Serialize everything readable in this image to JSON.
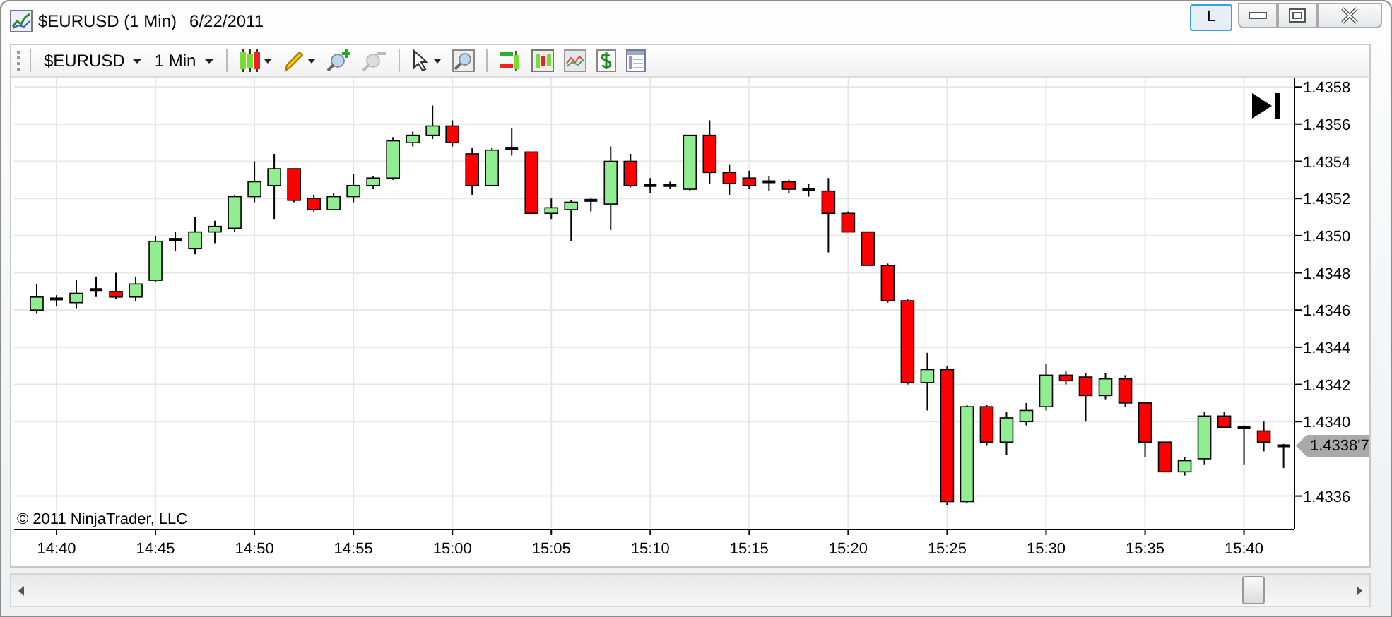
{
  "window": {
    "title": "$EURUSD (1 Min)",
    "date": "6/22/2011",
    "link_button": "L"
  },
  "toolbar": {
    "instrument": "$EURUSD",
    "interval": "1 Min"
  },
  "chart": {
    "copyright": "© 2011 NinjaTrader, LLC",
    "last_price_label": "1.4338'7",
    "chart_data": {
      "type": "candlestick",
      "grid": true,
      "categories": [
        null,
        "14:40",
        null,
        null,
        null,
        null,
        "14:45",
        null,
        null,
        null,
        null,
        "14:50",
        null,
        null,
        null,
        null,
        "14:55",
        null,
        null,
        null,
        null,
        "15:00",
        null,
        null,
        null,
        null,
        "15:05",
        null,
        null,
        null,
        null,
        "15:10",
        null,
        null,
        null,
        null,
        "15:15",
        null,
        null,
        null,
        null,
        "15:20",
        null,
        null,
        null,
        null,
        "15:25",
        null,
        null,
        null,
        null,
        "15:30",
        null,
        null,
        null,
        null,
        "15:35",
        null,
        null,
        null,
        null,
        "15:40",
        null,
        null
      ],
      "ohlc": [
        [
          1.4346,
          1.43474,
          1.43458,
          1.43467
        ],
        [
          1.43465,
          1.43468,
          1.43462,
          1.43466
        ],
        [
          1.43464,
          1.43476,
          1.43461,
          1.43469
        ],
        [
          1.4347,
          1.43478,
          1.43467,
          1.43471
        ],
        [
          1.4347,
          1.4348,
          1.43466,
          1.43467
        ],
        [
          1.43467,
          1.43478,
          1.43465,
          1.43474
        ],
        [
          1.43476,
          1.435,
          1.43475,
          1.43497
        ],
        [
          1.43497,
          1.43502,
          1.43492,
          1.43498
        ],
        [
          1.43493,
          1.4351,
          1.4349,
          1.43502
        ],
        [
          1.43502,
          1.43508,
          1.43496,
          1.43505
        ],
        [
          1.43504,
          1.43522,
          1.43502,
          1.43521
        ],
        [
          1.43521,
          1.4354,
          1.43518,
          1.43529
        ],
        [
          1.43527,
          1.43544,
          1.43509,
          1.43536
        ],
        [
          1.43536,
          1.43536,
          1.43518,
          1.43519
        ],
        [
          1.4352,
          1.43522,
          1.43513,
          1.43514
        ],
        [
          1.43514,
          1.43523,
          1.43514,
          1.43521
        ],
        [
          1.43521,
          1.43533,
          1.43518,
          1.43527
        ],
        [
          1.43527,
          1.43532,
          1.43525,
          1.43531
        ],
        [
          1.43531,
          1.43553,
          1.4353,
          1.43551
        ],
        [
          1.4355,
          1.43556,
          1.43548,
          1.43554
        ],
        [
          1.43554,
          1.4357,
          1.43552,
          1.43559
        ],
        [
          1.43559,
          1.43562,
          1.43548,
          1.4355
        ],
        [
          1.43544,
          1.43547,
          1.43522,
          1.43527
        ],
        [
          1.43527,
          1.43547,
          1.43527,
          1.43546
        ],
        [
          1.43546,
          1.43558,
          1.43543,
          1.43547
        ],
        [
          1.43545,
          1.43545,
          1.43512,
          1.43512
        ],
        [
          1.43512,
          1.4352,
          1.43509,
          1.43515
        ],
        [
          1.43514,
          1.43519,
          1.43497,
          1.43518
        ],
        [
          1.43519,
          1.4352,
          1.43513,
          1.43519
        ],
        [
          1.43517,
          1.43548,
          1.43503,
          1.4354
        ],
        [
          1.4354,
          1.43544,
          1.43526,
          1.43527
        ],
        [
          1.43527,
          1.43531,
          1.43523,
          1.43527
        ],
        [
          1.43527,
          1.43529,
          1.43525,
          1.43526
        ],
        [
          1.43525,
          1.43554,
          1.43524,
          1.43554
        ],
        [
          1.43554,
          1.43562,
          1.43528,
          1.43534
        ],
        [
          1.43534,
          1.43538,
          1.43522,
          1.43528
        ],
        [
          1.43531,
          1.43535,
          1.43525,
          1.43527
        ],
        [
          1.43529,
          1.43532,
          1.43524,
          1.43528
        ],
        [
          1.43529,
          1.4353,
          1.43523,
          1.43525
        ],
        [
          1.43525,
          1.43528,
          1.43521,
          1.43525
        ],
        [
          1.43524,
          1.43531,
          1.43491,
          1.43512
        ],
        [
          1.43512,
          1.43513,
          1.43502,
          1.43502
        ],
        [
          1.43502,
          1.43502,
          1.43484,
          1.43484
        ],
        [
          1.43484,
          1.43485,
          1.43464,
          1.43465
        ],
        [
          1.43465,
          1.43466,
          1.4342,
          1.43421
        ],
        [
          1.43421,
          1.43437,
          1.43406,
          1.43428
        ],
        [
          1.43428,
          1.4343,
          1.43355,
          1.43357
        ],
        [
          1.43357,
          1.43409,
          1.43356,
          1.43408
        ],
        [
          1.43408,
          1.43409,
          1.43387,
          1.43389
        ],
        [
          1.43389,
          1.43405,
          1.43382,
          1.43402
        ],
        [
          1.434,
          1.4341,
          1.43398,
          1.43406
        ],
        [
          1.43408,
          1.43431,
          1.43406,
          1.43425
        ],
        [
          1.43425,
          1.43427,
          1.4342,
          1.43422
        ],
        [
          1.43424,
          1.43426,
          1.434,
          1.43414
        ],
        [
          1.43414,
          1.43426,
          1.43412,
          1.43423
        ],
        [
          1.43423,
          1.43425,
          1.43408,
          1.4341
        ],
        [
          1.4341,
          1.4341,
          1.43381,
          1.43389
        ],
        [
          1.43389,
          1.43389,
          1.43373,
          1.43373
        ],
        [
          1.43373,
          1.43381,
          1.43371,
          1.43379
        ],
        [
          1.4338,
          1.43405,
          1.43377,
          1.43403
        ],
        [
          1.43403,
          1.43405,
          1.43397,
          1.43397
        ],
        [
          1.43397,
          1.43398,
          1.43377,
          1.43396
        ],
        [
          1.43395,
          1.434,
          1.43384,
          1.43389
        ],
        [
          1.43387,
          1.43388,
          1.43375,
          1.43387
        ]
      ],
      "ylim": [
        1.43342,
        1.43585
      ],
      "yticks": [
        {
          "value": 1.4358,
          "label": "1.4358"
        },
        {
          "value": 1.4356,
          "label": "1.4356"
        },
        {
          "value": 1.4354,
          "label": "1.4354"
        },
        {
          "value": 1.4352,
          "label": "1.4352"
        },
        {
          "value": 1.435,
          "label": "1.4350"
        },
        {
          "value": 1.4348,
          "label": "1.4348"
        },
        {
          "value": 1.4346,
          "label": "1.4346"
        },
        {
          "value": 1.4344,
          "label": "1.4344"
        },
        {
          "value": 1.4342,
          "label": "1.4342"
        },
        {
          "value": 1.434,
          "label": "1.4340"
        },
        {
          "value": 1.4336,
          "label": "1.4336"
        }
      ]
    }
  }
}
